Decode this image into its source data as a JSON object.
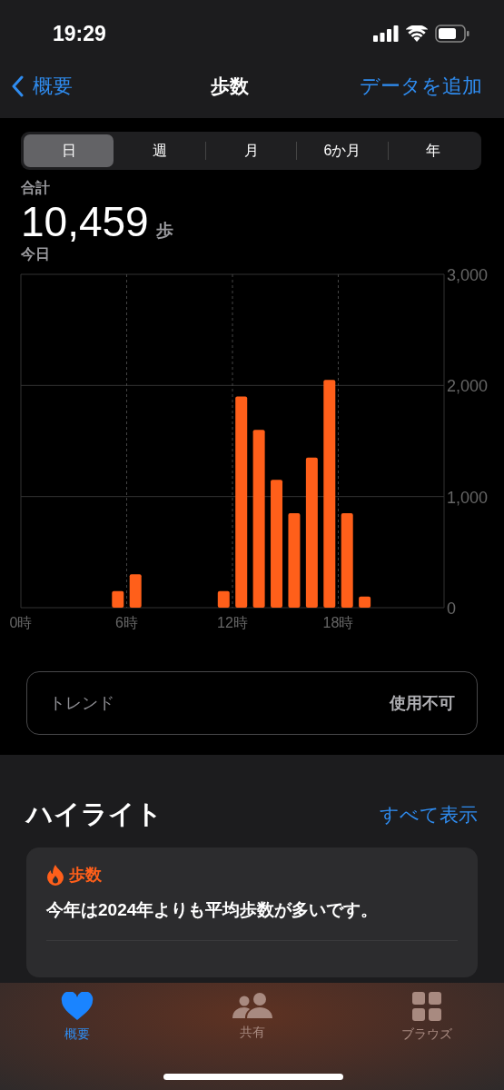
{
  "status_bar": {
    "time": "19:29"
  },
  "nav": {
    "back": "概要",
    "title": "歩数",
    "action": "データを追加"
  },
  "segments": [
    {
      "label": "日",
      "selected": true
    },
    {
      "label": "週",
      "selected": false
    },
    {
      "label": "月",
      "selected": false
    },
    {
      "label": "6か月",
      "selected": false
    },
    {
      "label": "年",
      "selected": false
    }
  ],
  "summary": {
    "label": "合計",
    "value": "10,459",
    "unit": "歩",
    "date": "今日"
  },
  "chart_data": {
    "type": "bar",
    "x": [
      0.5,
      1.5,
      2.5,
      3.5,
      4.5,
      5.5,
      6.5,
      7.5,
      8.5,
      9.5,
      10.5,
      11.5,
      12.5,
      13.5,
      14.5,
      15.5,
      16.5,
      17.5,
      18.5,
      19.5,
      20.5,
      21.5,
      22.5,
      23.5
    ],
    "xlim": [
      0,
      24
    ],
    "grid": true,
    "series": [
      {
        "color": "#ff5f1a",
        "values": [
          0,
          0,
          0,
          0,
          0,
          150,
          300,
          0,
          0,
          0,
          0,
          150,
          1900,
          1600,
          1150,
          850,
          1350,
          2050,
          850,
          100,
          0,
          0,
          0,
          0
        ]
      }
    ],
    "ylim": [
      0,
      3000
    ],
    "yticks": [
      {
        "value": 0,
        "label": "0"
      },
      {
        "value": 1000,
        "label": "1,000"
      },
      {
        "value": 2000,
        "label": "2,000"
      },
      {
        "value": 3000,
        "label": "3,000"
      }
    ],
    "xticks": [
      {
        "value": 0,
        "label": "0時"
      },
      {
        "value": 6,
        "label": "6時"
      },
      {
        "value": 12,
        "label": "12時"
      },
      {
        "value": 18,
        "label": "18時"
      }
    ]
  },
  "trend": {
    "label": "トレンド",
    "value": "使用不可"
  },
  "highlights": {
    "title": "ハイライト",
    "link": "すべて表示",
    "card": {
      "category": "歩数",
      "text": "今年は2024年よりも平均歩数が多いです。"
    }
  },
  "tab_bar": [
    {
      "label": "概要",
      "selected": true,
      "kind": "heart"
    },
    {
      "label": "共有",
      "selected": false,
      "kind": "people"
    },
    {
      "label": "ブラウズ",
      "selected": false,
      "kind": "grid"
    }
  ]
}
